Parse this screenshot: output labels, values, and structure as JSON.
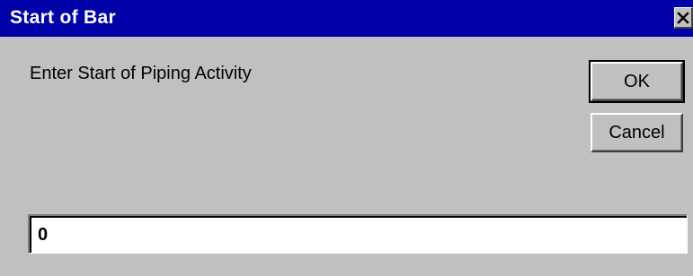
{
  "window": {
    "title": "Start of Bar",
    "close_icon": "close-icon"
  },
  "prompt": {
    "label": "Enter Start of Piping Activity"
  },
  "buttons": {
    "ok_label": "OK",
    "cancel_label": "Cancel"
  },
  "input": {
    "value": "0"
  },
  "colors": {
    "titlebar": "#0000a8",
    "face": "#c0c0c0",
    "title_text": "#ffffff"
  }
}
